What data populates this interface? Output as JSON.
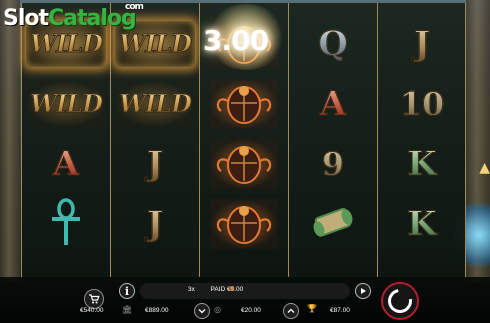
{
  "logo": {
    "part1": "Slot",
    "part2": "Catalog",
    "suffix": "com"
  },
  "win_amount": "3.00",
  "reels": [
    [
      "WILD",
      "WILD",
      "A",
      "ankh"
    ],
    [
      "WILD",
      "WILD",
      "J",
      "J"
    ],
    [
      "scarab",
      "scarab",
      "scarab",
      "scarab"
    ],
    [
      "Q",
      "A",
      "9",
      "scroll"
    ],
    [
      "J",
      "10",
      "K",
      "K"
    ]
  ],
  "lit_wilds": [
    [
      0,
      0
    ],
    [
      1,
      0
    ]
  ],
  "bottom_bar": {
    "win_info_prefix": "3x",
    "win_info_text": "PAID €3.00",
    "balance": "€540.00",
    "bank": "€889.00",
    "bet": "€20.00",
    "win": "€87.00"
  },
  "icons": {
    "cart": "cart-icon",
    "info": "info-icon",
    "bank": "bank-icon",
    "coin": "coin-icon",
    "trophy": "trophy-icon",
    "play": "play-icon",
    "spin": "spin-icon",
    "bet_down": "chevron-down-icon",
    "bet_up": "chevron-up-icon"
  },
  "colors": {
    "reel_border": "#a28a58",
    "spin_ring": "#b11d2a",
    "logo_green": "#36b441"
  }
}
